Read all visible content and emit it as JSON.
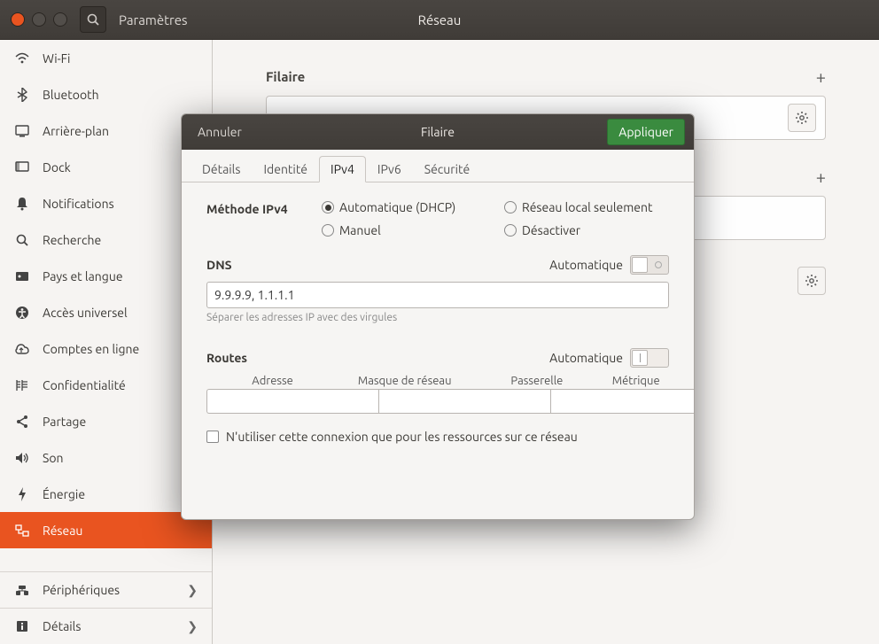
{
  "header": {
    "app": "Paramètres",
    "title": "Réseau"
  },
  "sidebar": {
    "items": [
      {
        "label": "Wi-Fi"
      },
      {
        "label": "Bluetooth"
      },
      {
        "label": "Arrière-plan"
      },
      {
        "label": "Dock"
      },
      {
        "label": "Notifications"
      },
      {
        "label": "Recherche"
      },
      {
        "label": "Pays et langue"
      },
      {
        "label": "Accès universel"
      },
      {
        "label": "Comptes en ligne"
      },
      {
        "label": "Confidentialité"
      },
      {
        "label": "Partage"
      },
      {
        "label": "Son"
      },
      {
        "label": "Énergie"
      },
      {
        "label": "Réseau"
      }
    ],
    "footer": [
      {
        "label": "Périphériques"
      },
      {
        "label": "Détails"
      }
    ]
  },
  "content": {
    "section1": "Filaire"
  },
  "dialog": {
    "cancel": "Annuler",
    "title": "Filaire",
    "apply": "Appliquer",
    "tabs": {
      "details": "Détails",
      "identite": "Identité",
      "ipv4": "IPv4",
      "ipv6": "IPv6",
      "security": "Sécurité"
    },
    "method_label": "Méthode IPv4",
    "methods": {
      "auto": "Automatique (DHCP)",
      "local": "Réseau local seulement",
      "manual": "Manuel",
      "disable": "Désactiver"
    },
    "dns": {
      "heading": "DNS",
      "auto_label": "Automatique",
      "value": "9.9.9.9, 1.1.1.1",
      "hint": "Séparer les adresses IP avec des virgules"
    },
    "routes": {
      "heading": "Routes",
      "auto_label": "Automatique",
      "cols": {
        "addr": "Adresse",
        "mask": "Masque de réseau",
        "gw": "Passerelle",
        "metric": "Métrique"
      }
    },
    "only_resources": "N'utiliser cette connexion que pour les ressources sur ce réseau"
  }
}
